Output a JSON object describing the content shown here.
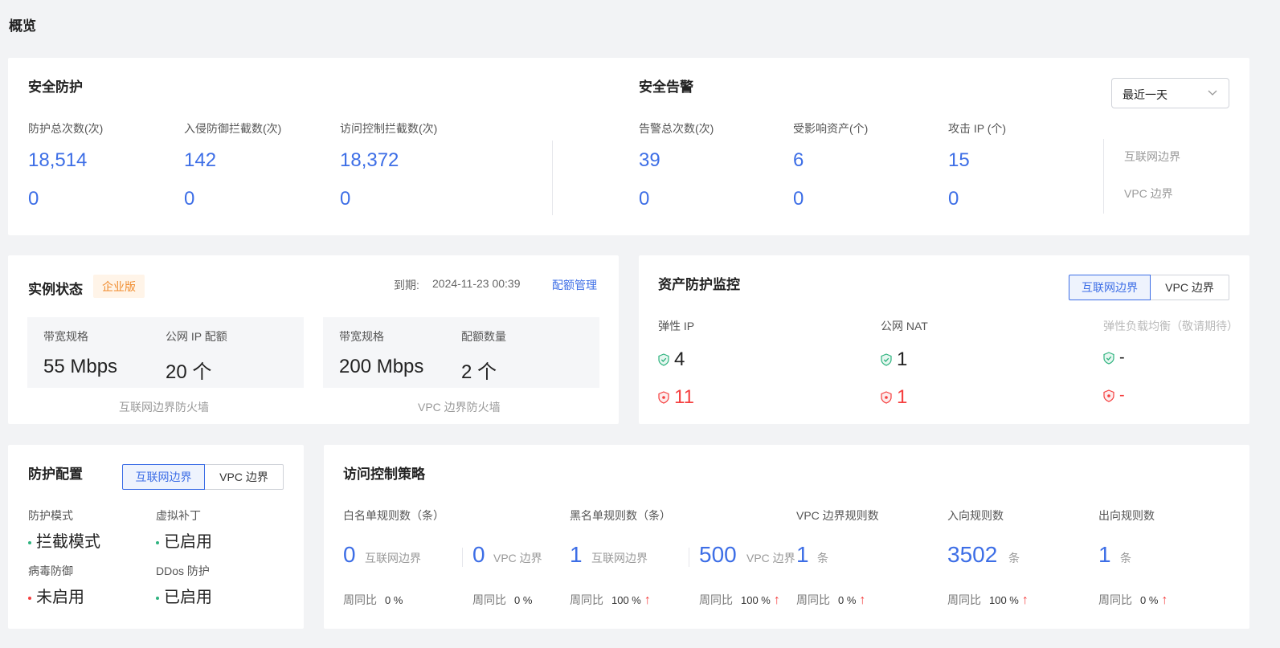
{
  "page_title": "概览",
  "security": {
    "title": "安全防护",
    "cols": [
      {
        "label": "防护总次数(次)",
        "value": "18,514",
        "sub": "0"
      },
      {
        "label": "入侵防御拦截数(次)",
        "value": "142",
        "sub": "0"
      },
      {
        "label": "访问控制拦截数(次)",
        "value": "18,372",
        "sub": "0"
      }
    ]
  },
  "alerts": {
    "title": "安全告警",
    "range": "最近一天",
    "cols": [
      {
        "label": "告警总次数(次)",
        "value": "39",
        "sub": "0"
      },
      {
        "label": "受影响资产(个)",
        "value": "6",
        "sub": "0"
      },
      {
        "label": "攻击 IP (个)",
        "value": "15",
        "sub": "0"
      }
    ],
    "legend": [
      "互联网边界",
      "VPC 边界"
    ]
  },
  "instance": {
    "title": "实例状态",
    "edition": "企业版",
    "expire_label": "到期:",
    "expire_value": "2024-11-23 00:39",
    "quota_link": "配额管理",
    "boxes": [
      {
        "l1": "带宽规格",
        "v1": "55 Mbps",
        "l2": "公网 IP 配额",
        "v2": "20 个",
        "caption": "互联网边界防火墙"
      },
      {
        "l1": "带宽规格",
        "v1": "200 Mbps",
        "l2": "配额数量",
        "v2": "2 个",
        "caption": "VPC 边界防火墙"
      }
    ]
  },
  "asset": {
    "title": "资产防护监控",
    "tabs": [
      "互联网边界",
      "VPC 边界"
    ],
    "cols": [
      {
        "label": "弹性 IP",
        "protected": "4",
        "unprotected": "11"
      },
      {
        "label": "公网 NAT",
        "protected": "1",
        "unprotected": "1"
      },
      {
        "label": "弹性负载均衡（敬请期待）",
        "protected": "-",
        "unprotected": "-"
      }
    ],
    "colors": {
      "green": "#2fb37f",
      "red": "#f53f3f"
    }
  },
  "config": {
    "title": "防护配置",
    "tabs": [
      "互联网边界",
      "VPC 边界"
    ],
    "items": [
      {
        "label": "防护模式",
        "value": "拦截模式",
        "status": "green"
      },
      {
        "label": "虚拟补丁",
        "value": "已启用",
        "status": "green"
      },
      {
        "label": "病毒防御",
        "value": "未启用",
        "status": "red"
      },
      {
        "label": "DDos 防护",
        "value": "已启用",
        "status": "green"
      }
    ]
  },
  "acl": {
    "title": "访问控制策略",
    "white": {
      "label": "白名单规则数（条）",
      "a_num": "0",
      "a_tag": "互联网边界",
      "b_num": "0",
      "b_tag": "VPC 边界",
      "a_wk": "0 %",
      "b_wk": "0 %"
    },
    "black": {
      "label": "黑名单规则数（条）",
      "a_num": "1",
      "a_tag": "互联网边界",
      "b_num": "500",
      "b_tag": "VPC 边界",
      "a_wk": "100 %",
      "b_wk": "100 %"
    },
    "vpc": {
      "label": "VPC 边界规则数",
      "num": "1",
      "unit": "条",
      "wk": "0 %"
    },
    "inbound": {
      "label": "入向规则数",
      "num": "3502",
      "unit": "条",
      "wk": "100 %"
    },
    "outbound": {
      "label": "出向规则数",
      "num": "1",
      "unit": "条",
      "wk": "0 %"
    },
    "wk_label": "周同比",
    "up_arrow": "↑"
  }
}
